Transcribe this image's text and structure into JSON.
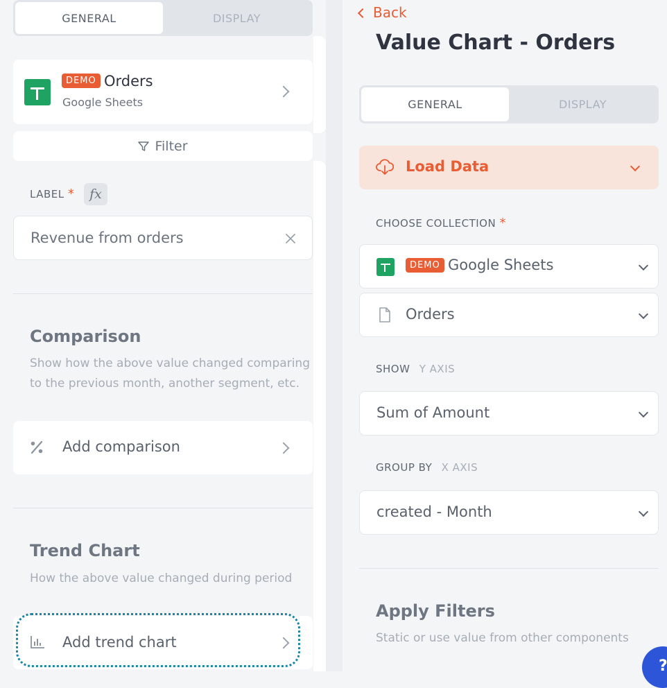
{
  "left": {
    "tabs": [
      "GENERAL",
      "DISPLAY"
    ],
    "source": {
      "badge": "DEMO",
      "name": "Orders",
      "subtitle": "Google Sheets"
    },
    "filter_label": "Filter",
    "label_field": {
      "label": "LABEL",
      "required_mark": "*",
      "fx": "fx",
      "value": "Revenue from orders"
    },
    "comparison": {
      "title": "Comparison",
      "description": "Show how the above value changed comparing to the previous month, another segment, etc.",
      "button": "Add comparison"
    },
    "trend": {
      "title": "Trend Chart",
      "description": "How the above value changed during period",
      "button": "Add trend chart"
    }
  },
  "right": {
    "back": "Back",
    "title": "Value Chart - Orders",
    "tabs": [
      "GENERAL",
      "DISPLAY"
    ],
    "load_data": "Load Data",
    "choose_collection": {
      "label": "CHOOSE COLLECTION",
      "required_mark": "*"
    },
    "collection": {
      "badge": "DEMO",
      "name": "Google Sheets"
    },
    "table": "Orders",
    "show": {
      "label": "SHOW",
      "sub": "Y AXIS",
      "value": "Sum of Amount"
    },
    "group_by": {
      "label": "GROUP BY",
      "sub": "X AXIS",
      "value": "created - Month"
    },
    "apply_filters": {
      "title": "Apply Filters",
      "description": "Static or use value from other components"
    },
    "help_glyph": "?"
  },
  "colors": {
    "accent": "#e85d34",
    "sheets": "#1ea362",
    "highlight": "#1a86a6"
  }
}
